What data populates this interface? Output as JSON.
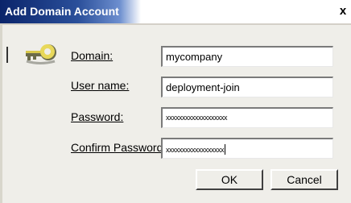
{
  "window": {
    "title": "Add Domain Account",
    "close_glyph": "x"
  },
  "icon": {
    "name": "key-icon"
  },
  "form": {
    "domain_label": "Domain:",
    "domain_value": "mycompany",
    "username_label": "User name:",
    "username_value": "deployment-join",
    "password_label": "Password:",
    "password_value": "xxxxxxxxxxxxxxxxxxx",
    "confirm_label": "Confirm Password:",
    "confirm_value": "xxxxxxxxxxxxxxxxxx"
  },
  "buttons": {
    "ok_label": "OK",
    "cancel_label": "Cancel"
  }
}
